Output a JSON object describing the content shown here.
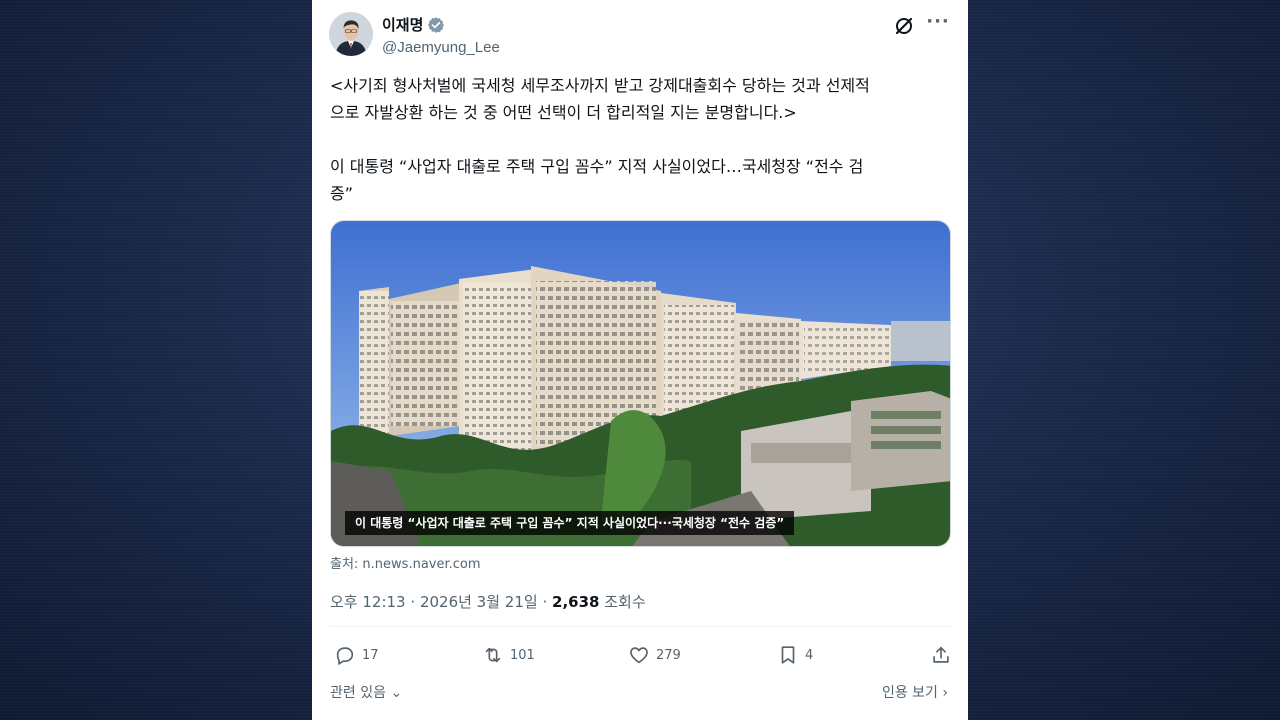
{
  "author": {
    "display_name": "이재명",
    "handle": "@Jaemyung_Lee"
  },
  "icons": {
    "verified": "verified-badge-icon",
    "grok": "grok-icon",
    "more": "more-icon",
    "reply": "reply-icon",
    "retweet": "retweet-icon",
    "like": "heart-icon",
    "bookmark": "bookmark-icon",
    "share": "share-icon"
  },
  "tweet": {
    "text": "<사기죄 형사처벌에 국세청 세무조사까지 받고 강제대출회수 당하는 것과 선제적\n으로 자발상환 하는 것 중 어떤 선택이 더 합리적일 지는 분명합니다.>\n\n이 대통령 “사업자 대출로 주택 구입 꼼수” 지적 사실이었다…국세청장 “전수 검\n증”",
    "media_caption": "이 대통령 “사업자 대출로 주택 구입 꼼수” 지적 사실이었다···국세청장 “전수 검증”",
    "source_label": "출처: n.news.naver.com",
    "time": "오후 12:13",
    "date": "2026년 3월 21일",
    "views_count": "2,638",
    "views_label": "조회수"
  },
  "stats": {
    "replies": "17",
    "retweets": "101",
    "likes": "279",
    "bookmarks": "4"
  },
  "footer": {
    "related": "관련 있음",
    "quotes": "인용 보기"
  },
  "colors": {
    "background": "#1b2b4d",
    "verified": "#829aab",
    "text_secondary": "#536471",
    "text_primary": "#0f1419"
  }
}
